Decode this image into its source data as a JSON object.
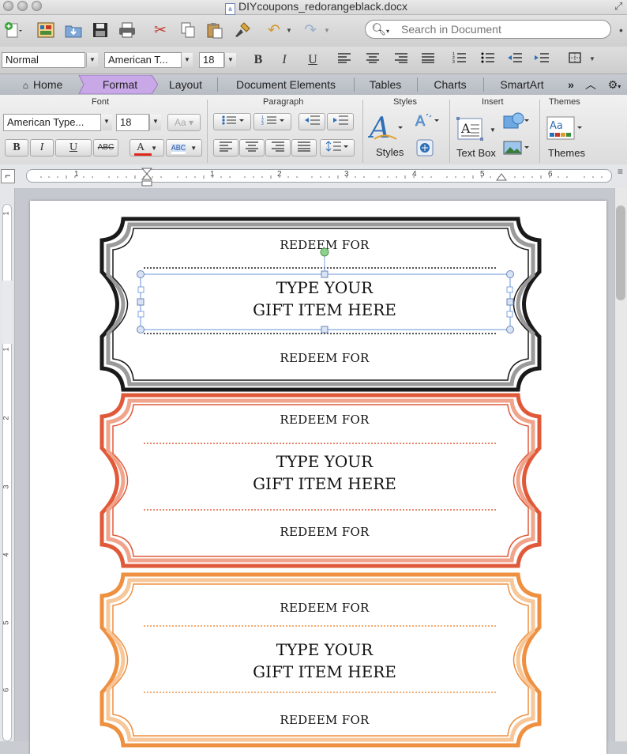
{
  "window": {
    "title": "DIYcoupons_redorangeblack.docx"
  },
  "search": {
    "placeholder": "Search in Document"
  },
  "formatbar": {
    "style": "Normal",
    "font": "American T...",
    "size": "18",
    "bold": "B",
    "italic": "I",
    "underline": "U"
  },
  "tabs": [
    {
      "label": "Home"
    },
    {
      "label": "Format"
    },
    {
      "label": "Layout"
    },
    {
      "label": "Document Elements"
    },
    {
      "label": "Tables"
    },
    {
      "label": "Charts"
    },
    {
      "label": "SmartArt"
    }
  ],
  "ribbon": {
    "groups": {
      "font": "Font",
      "paragraph": "Paragraph",
      "styles": "Styles",
      "insert": "Insert",
      "themes": "Themes"
    },
    "font_name": "American Type...",
    "font_size": "18",
    "styles_label": "Styles",
    "textbox_label": "Text Box",
    "themes_label": "Themes",
    "bold": "B",
    "italic": "I",
    "underline": "U",
    "strike": "ABC",
    "font_color": "A",
    "highlight": "ABC"
  },
  "ruler": {
    "numbers": [
      "1",
      "1",
      "2",
      "3",
      "4",
      "5",
      "6"
    ]
  },
  "vruler": {
    "numbers": [
      "1",
      "1",
      "2",
      "3",
      "4",
      "5",
      "6"
    ]
  },
  "coupons": [
    {
      "color": "#1a1a1a",
      "top_label": "REDEEM FOR",
      "gift_line1": "TYPE YOUR",
      "gift_line2": "GIFT ITEM HERE",
      "bottom_label": "REDEEM FOR"
    },
    {
      "color": "#e05a3a",
      "top_label": "REDEEM FOR",
      "gift_line1": "TYPE YOUR",
      "gift_line2": "GIFT ITEM HERE",
      "bottom_label": "REDEEM FOR"
    },
    {
      "color": "#ee9040",
      "top_label": "REDEEM FOR",
      "gift_line1": "TYPE YOUR",
      "gift_line2": "GIFT ITEM HERE",
      "bottom_label": "REDEEM FOR"
    }
  ],
  "colors": {
    "format_tab": "#c9a8e8",
    "selection": "#7fa6e0",
    "font_color_bar": "#e0281c"
  }
}
